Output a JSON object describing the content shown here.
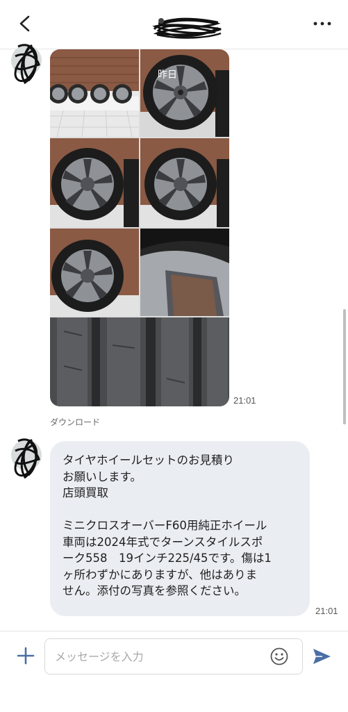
{
  "header": {
    "back_icon": "chevron-left-icon",
    "title_redacted": true,
    "more_icon": "more-horizontal-icon"
  },
  "messages": [
    {
      "sender": "other",
      "type": "photo-album",
      "photos": [
        {
          "subject": "four wheels against brick wall",
          "overlay_text": ""
        },
        {
          "subject": "wheel close-up",
          "overlay_text": "昨日"
        },
        {
          "subject": "wheel front view",
          "overlay_text": ""
        },
        {
          "subject": "wheel front view",
          "overlay_text": ""
        },
        {
          "subject": "wheel front view",
          "overlay_text": ""
        },
        {
          "subject": "wheel spoke detail",
          "overlay_text": ""
        },
        {
          "subject": "tire tread close-up",
          "overlay_text": ""
        }
      ],
      "time": "21:01",
      "download_label": "ダウンロード"
    },
    {
      "sender": "other",
      "type": "text",
      "text": "タイヤホイールセットのお見積り\nお願いします。\n店頭買取\n\nミニクロスオーバーF60用純正ホイール\n車両は2024年式でターンスタイルスポ\nーク558　19インチ225/45です。傷は1\nヶ所わずかにありますが、他はありま\nせん。添付の写真を参照ください。",
      "time": "21:01"
    }
  ],
  "composer": {
    "plus_icon": "plus-icon",
    "placeholder": "メッセージを入力",
    "value": "",
    "emoji_icon": "emoji-smile-icon",
    "send_icon": "send-icon"
  },
  "colors": {
    "accent": "#4a6fa5",
    "bubble_bg": "#eaedf2",
    "header_bg": "#ffffff"
  }
}
